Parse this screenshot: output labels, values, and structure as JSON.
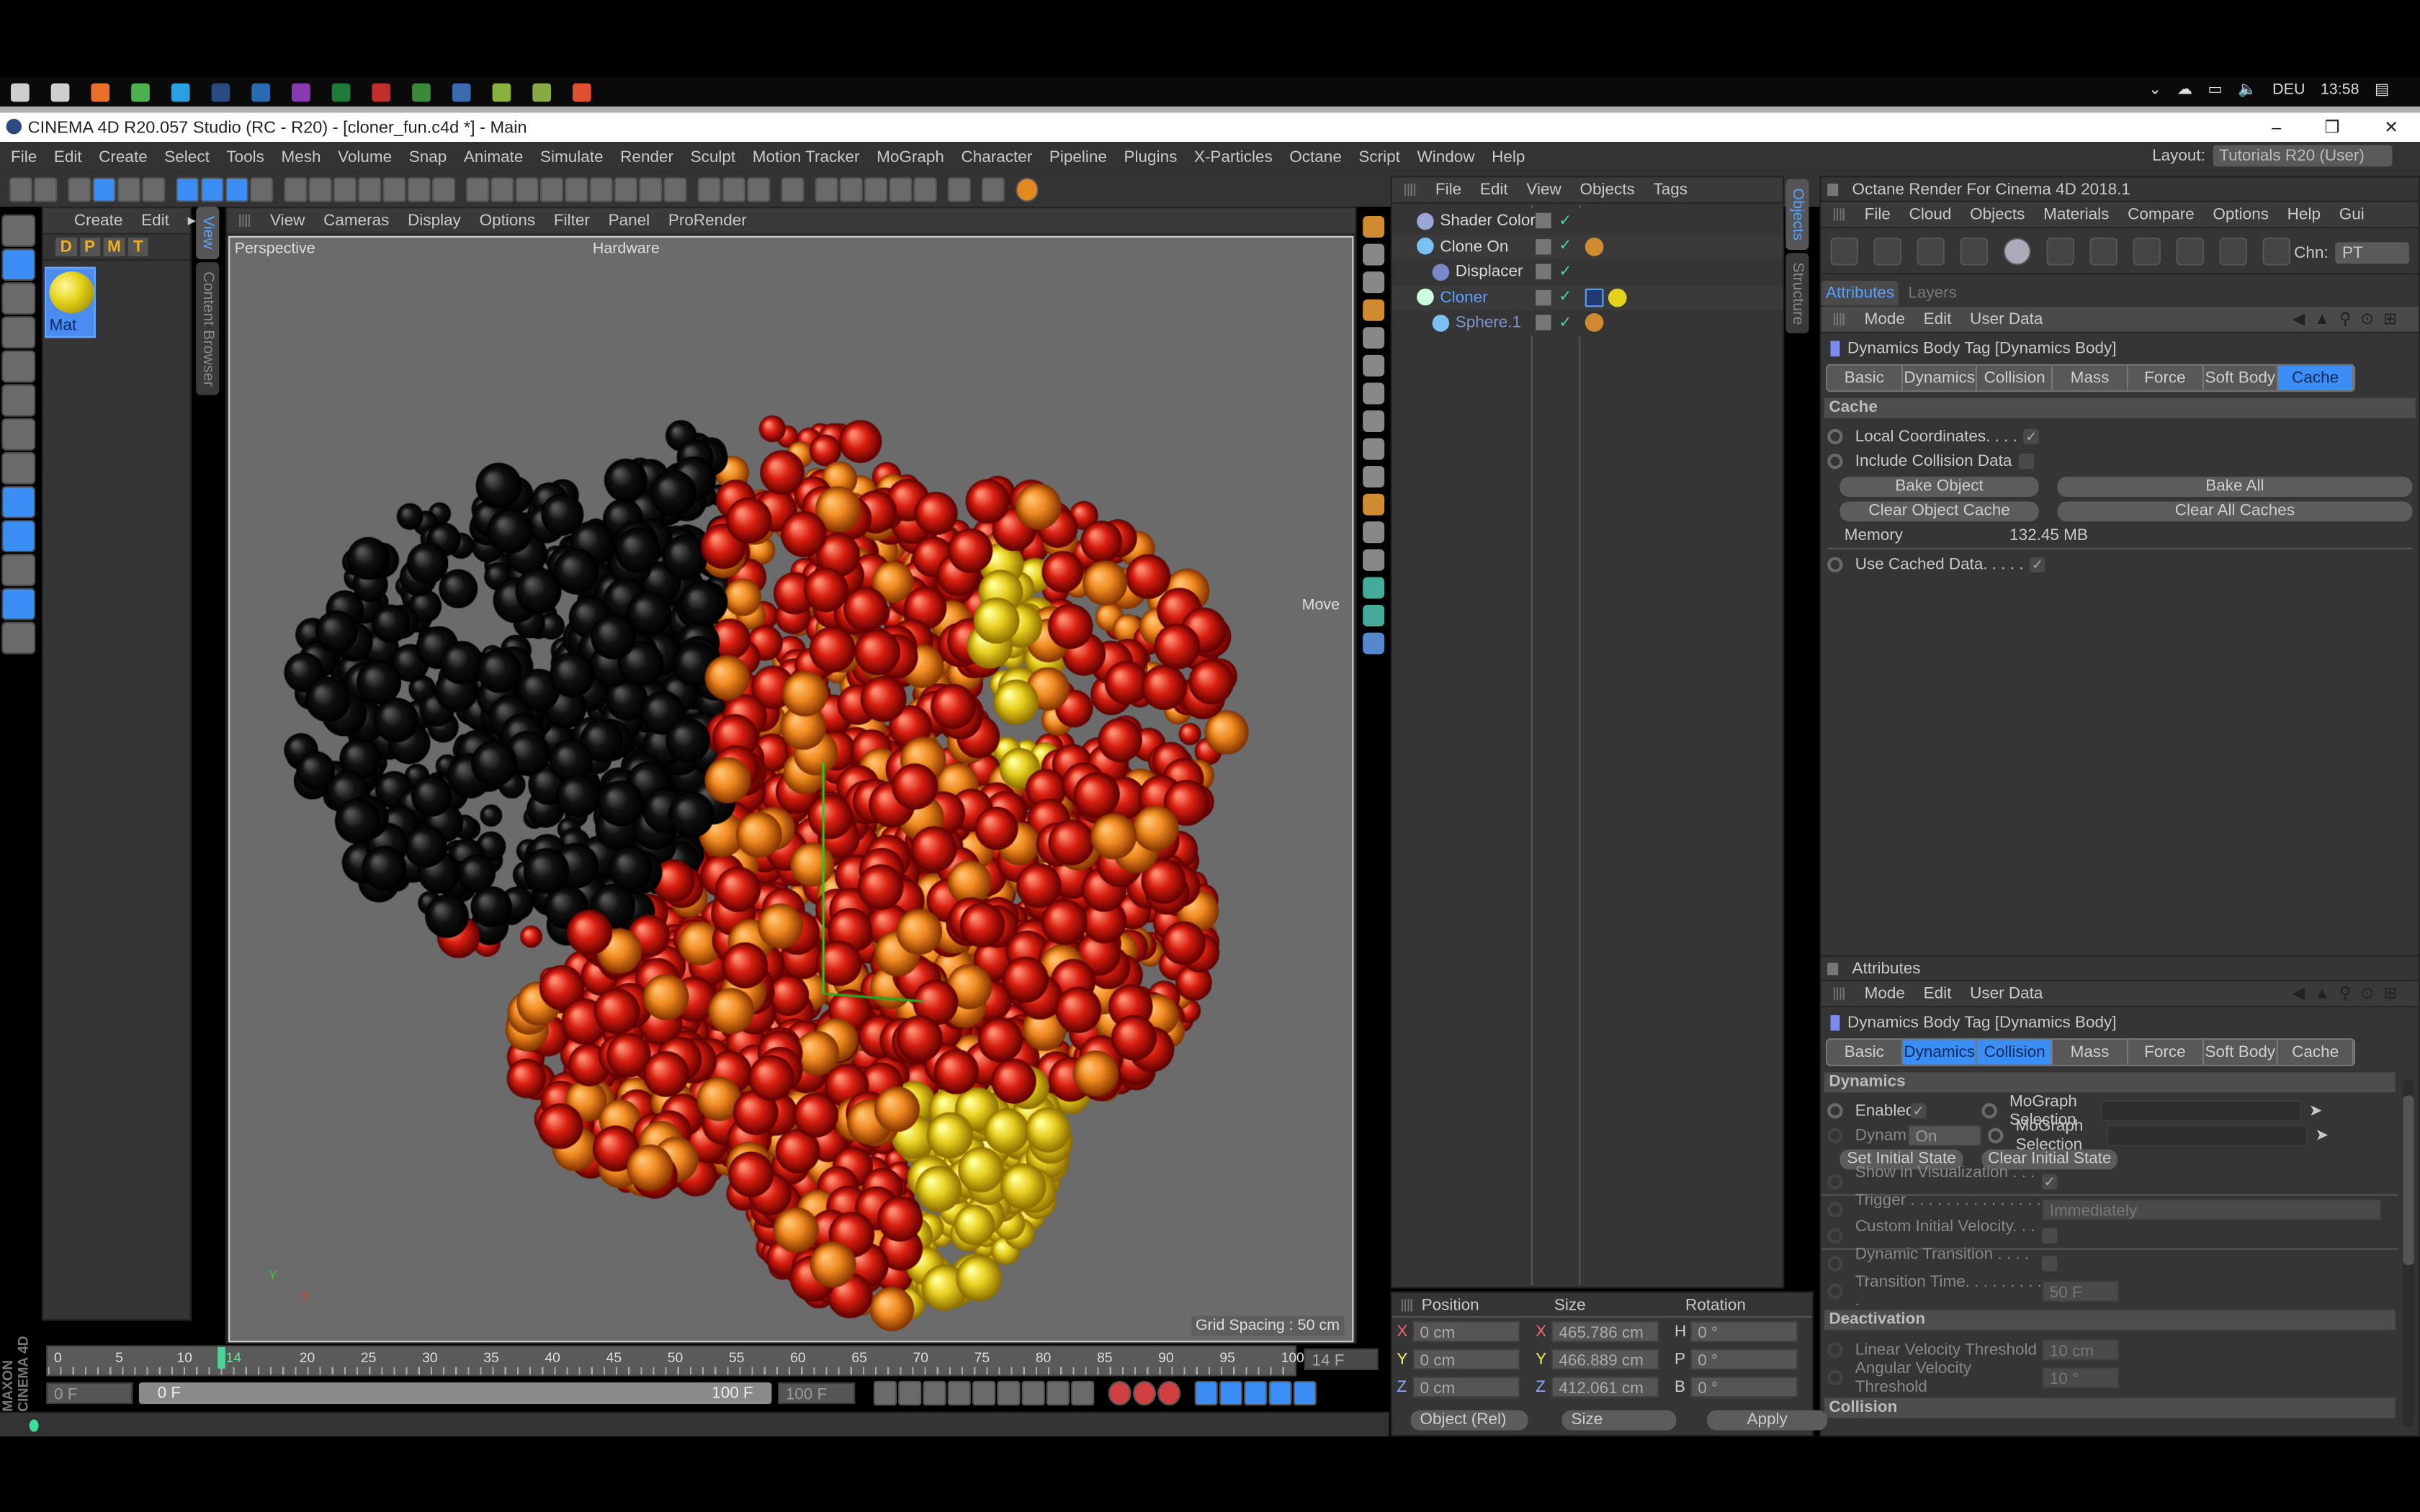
{
  "taskbar": {
    "apps": [
      "windows-start",
      "cortana",
      "firefox",
      "chrome",
      "skype",
      "c4d",
      "photoshop",
      "premiere",
      "excel",
      "acrobat",
      "wacom",
      "c4d-2",
      "camtasia",
      "notepad",
      "other"
    ],
    "lang": "DEU",
    "time": "13:58"
  },
  "window": {
    "title": "CINEMA 4D R20.057 Studio (RC - R20) - [cloner_fun.c4d *] - Main",
    "min": "–",
    "max": "❐",
    "close": "✕"
  },
  "menubar": {
    "items": [
      "File",
      "Edit",
      "Create",
      "Select",
      "Tools",
      "Mesh",
      "Volume",
      "Snap",
      "Animate",
      "Simulate",
      "Render",
      "Sculpt",
      "Motion Tracker",
      "MoGraph",
      "Character",
      "Pipeline",
      "Plugins",
      "X-Particles",
      "Octane",
      "Script",
      "Window",
      "Help"
    ],
    "layout_label": "Layout:",
    "layout_value": "Tutorials R20 (User)"
  },
  "material_manager": {
    "menu": [
      "Create",
      "Edit"
    ],
    "filters": [
      "D",
      "P",
      "M",
      "T"
    ],
    "material": {
      "name": "Mat",
      "color": "#e6d21c"
    }
  },
  "side_tabs": [
    "View",
    "Content Browser"
  ],
  "viewport": {
    "menu": [
      "View",
      "Cameras",
      "Display",
      "Options",
      "Filter",
      "Panel",
      "ProRender"
    ],
    "camera": "Perspective",
    "renderer": "Hardware",
    "tool": "Move",
    "grid": "Grid Spacing : 50 cm",
    "axis": {
      "y": "Y",
      "x": "X"
    }
  },
  "objects": {
    "menu": [
      "File",
      "Edit",
      "View",
      "Objects",
      "Tags"
    ],
    "rows": [
      {
        "name": "Shader Color",
        "level": 0,
        "color": "#d8d8d8",
        "tags": []
      },
      {
        "name": "Clone On",
        "level": 0,
        "color": "#d8d8d8",
        "tags": [
          "phong"
        ]
      },
      {
        "name": "Displacer",
        "level": 1,
        "color": "#d8d8d8",
        "tags": []
      },
      {
        "name": "Cloner",
        "level": 0,
        "color": "#5aa0ff",
        "tags": [
          "dynamics-body",
          "material"
        ]
      },
      {
        "name": "Sphere.1",
        "level": 1,
        "color": "#7b93c9",
        "tags": [
          "phong"
        ]
      }
    ],
    "tabs": [
      "Objects",
      "Structure"
    ]
  },
  "coords": {
    "headers": [
      "Position",
      "Size",
      "Rotation"
    ],
    "rows": [
      {
        "pl": "X",
        "p": "0 cm",
        "sl": "X",
        "s": "465.786 cm",
        "rl": "H",
        "r": "0 °"
      },
      {
        "pl": "Y",
        "p": "0 cm",
        "sl": "Y",
        "s": "466.889 cm",
        "rl": "P",
        "r": "0 °"
      },
      {
        "pl": "Z",
        "p": "0 cm",
        "sl": "Z",
        "s": "412.061 cm",
        "rl": "B",
        "r": "0 °"
      }
    ],
    "mode": "Object (Rel)",
    "size_mode": "Size",
    "apply": "Apply"
  },
  "octane": {
    "title": "Octane Render For Cinema 4D 2018.1",
    "menu": [
      "File",
      "Cloud",
      "Objects",
      "Materials",
      "Compare",
      "Options",
      "Help",
      "Gui"
    ],
    "chn_label": "Chn:",
    "chn_value": "PT"
  },
  "attr_top": {
    "tabs": [
      "Attributes",
      "Layers"
    ],
    "menu": [
      "Mode",
      "Edit",
      "User Data"
    ],
    "object": "Dynamics Body Tag [Dynamics Body]",
    "tag_tabs": [
      "Basic",
      "Dynamics",
      "Collision",
      "Mass",
      "Force",
      "Soft Body",
      "Cache"
    ],
    "active_tab": "Cache",
    "section": "Cache",
    "local_coords": "Local Coordinates. . . .",
    "include_collision": "Include Collision Data",
    "bake_object": "Bake Object",
    "bake_all": "Bake All",
    "clear_object": "Clear Object Cache",
    "clear_all": "Clear All Caches",
    "memory_label": "Memory",
    "memory_value": "132.45 MB",
    "use_cached": "Use Cached Data. . . . .",
    "check": "✓"
  },
  "attr_bottom": {
    "title": "Attributes",
    "menu": [
      "Mode",
      "Edit",
      "User Data"
    ],
    "object": "Dynamics Body Tag [Dynamics Body]",
    "tag_tabs": [
      "Basic",
      "Dynamics",
      "Collision",
      "Mass",
      "Force",
      "Soft Body",
      "Cache"
    ],
    "active_tabs": [
      "Dynamics",
      "Collision"
    ],
    "section": "Dynamics",
    "enabled": "Enabled",
    "mograph": "MoGraph Selection",
    "dynamic": "Dynamic",
    "dynamic_value": "On",
    "set_initial": "Set Initial State",
    "clear_initial": "Clear Initial State",
    "show_vis": "Show in Visualization . . . . .",
    "trigger": "Trigger . . . . . . . . . . . . . . . . .",
    "trigger_value": "Immediately",
    "custom_vel": "Custom Initial Velocity. . . .",
    "dyn_trans": "Dynamic Transition . . . . . .",
    "trans_time": "Transition Time. . . . . . . . . .",
    "trans_value": "50 F",
    "deactivation": "Deactivation",
    "lin_vel": "Linear Velocity Threshold",
    "lin_value": "10 cm",
    "ang_vel": "Angular Velocity Threshold",
    "ang_value": "10 °",
    "collision": "Collision"
  },
  "timeline": {
    "ticks": [
      "0",
      "5",
      "10",
      "14",
      "20",
      "25",
      "30",
      "35",
      "40",
      "45",
      "50",
      "55",
      "60",
      "65",
      "70",
      "75",
      "80",
      "85",
      "90",
      "95",
      "100"
    ],
    "current": 14,
    "max": 100,
    "current_field": "14 F",
    "start": "0 F",
    "range_start": "0 F",
    "range_end": "100 F",
    "end": "100 F"
  },
  "brand": "MAXON CINEMA 4D"
}
